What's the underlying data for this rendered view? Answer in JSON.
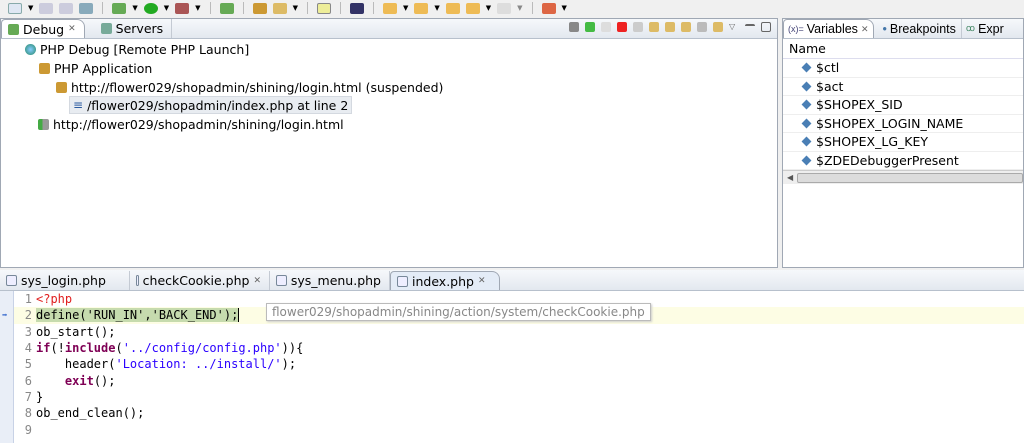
{
  "debug_view": {
    "tabs": [
      {
        "label": "Debug",
        "icon": "debug-icon"
      },
      {
        "label": "Servers",
        "icon": "servers-icon"
      }
    ],
    "tree": [
      {
        "label": "PHP Debug [Remote PHP Launch]",
        "icon": "launch-globe-icon"
      },
      {
        "label": "PHP Application",
        "icon": "php-application-icon"
      },
      {
        "label": "http://flower029/shopadmin/shining/login.html (suspended)",
        "icon": "thread-suspended-icon"
      },
      {
        "label": "/flower029/shopadmin/index.php at line 2",
        "icon": "stack-frame-icon"
      },
      {
        "label": "http://flower029/shopadmin/shining/login.html",
        "icon": "process-icon"
      }
    ]
  },
  "variables_view": {
    "tabs": [
      {
        "label": "Variables"
      },
      {
        "label": "Breakpoints"
      },
      {
        "label": "Expr"
      }
    ],
    "column": "Name",
    "items": [
      "$ctl",
      "$act",
      "$SHOPEX_SID",
      "$SHOPEX_LOGIN_NAME",
      "$SHOPEX_LG_KEY",
      "$ZDEDebuggerPresent"
    ]
  },
  "editor": {
    "tabs": [
      {
        "label": "sys_login.php"
      },
      {
        "label": "checkCookie.php"
      },
      {
        "label": "sys_menu.php"
      },
      {
        "label": "index.php"
      }
    ],
    "active_tab": "index.php",
    "lines": {
      "l1": "<?php",
      "l2": "define('RUN_IN','BACK_END');",
      "l3": "ob_start();",
      "l4a": "if",
      "l4b": "(!",
      "l4c": "include",
      "l4d": "(",
      "l4e": "'../config/config.php'",
      "l4f": ")){",
      "l5a": "    header(",
      "l5b": "'Location: ../install/'",
      "l5c": ");",
      "l6a": "    ",
      "l6b": "exit",
      "l6c": "();",
      "l7": "}",
      "l8": "ob_end_clean();"
    },
    "line_numbers": [
      "1",
      "2",
      "3",
      "4",
      "5",
      "6",
      "7",
      "8",
      "9"
    ],
    "current_line": 2,
    "tooltip": "flower029/shopadmin/shining/action/system/checkCookie.php"
  }
}
